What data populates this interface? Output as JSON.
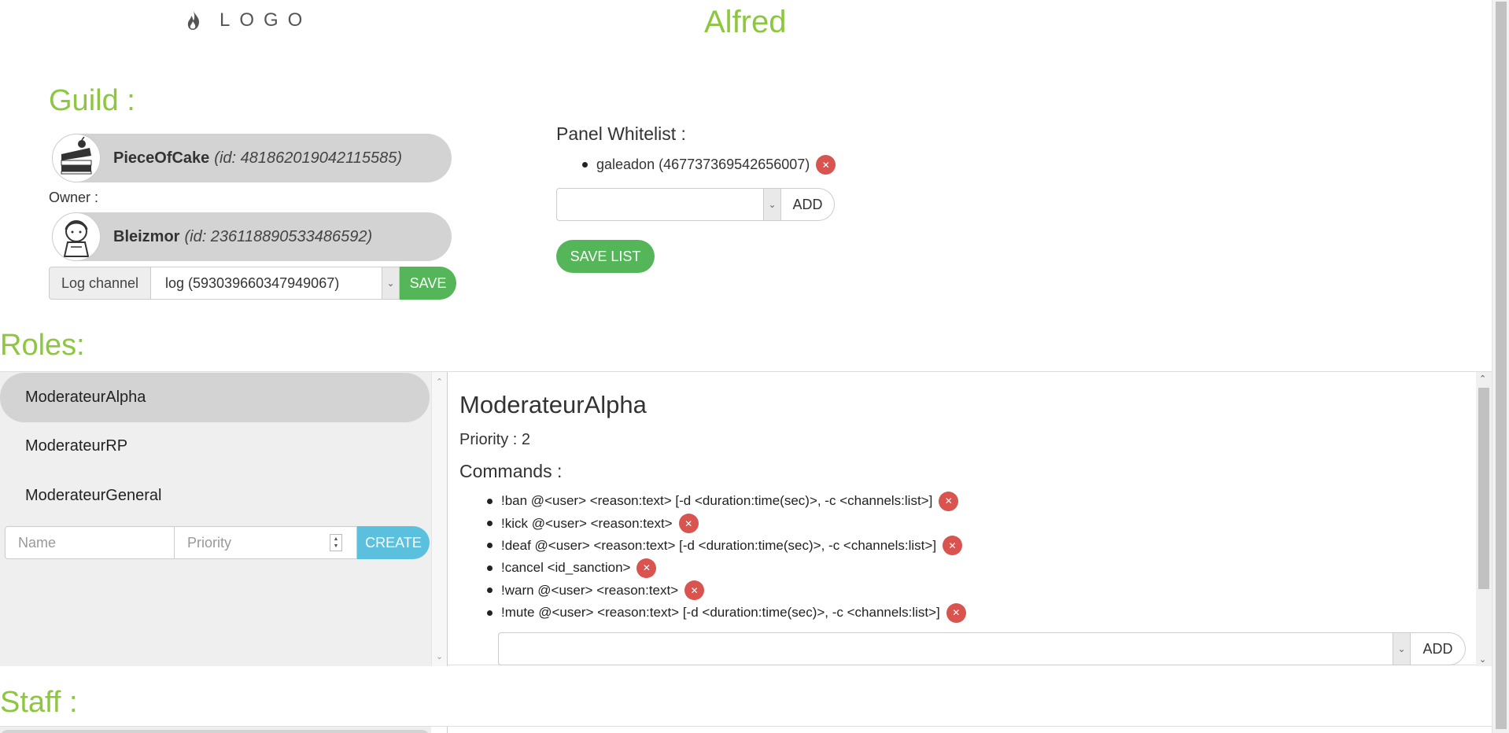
{
  "header": {
    "logo_text": "LOGO",
    "logo_icon": "flame-icon",
    "app_title": "Alfred"
  },
  "guild": {
    "section_title": "Guild :",
    "name": "PieceOfCake",
    "id_text": "(id: 481862019042115585)",
    "owner_label": "Owner :",
    "owner_name": "Bleizmor",
    "owner_id_text": "(id: 236118890533486592)",
    "log_channel_label": "Log channel",
    "log_channel_value": "log (593039660347949067)",
    "save_label": "SAVE"
  },
  "whitelist": {
    "title": "Panel Whitelist :",
    "items": [
      "galeadon (467737369542656007)"
    ],
    "add_label": "ADD",
    "save_list_label": "SAVE LIST"
  },
  "roles": {
    "section_title": "Roles:",
    "items": [
      {
        "label": "ModerateurAlpha",
        "active": true
      },
      {
        "label": "ModerateurRP",
        "active": false
      },
      {
        "label": "ModerateurGeneral",
        "active": false
      }
    ],
    "name_placeholder": "Name",
    "priority_placeholder": "Priority",
    "create_label": "CREATE",
    "selected": {
      "title": "ModerateurAlpha",
      "priority_text": "Priority : 2",
      "commands_title": "Commands :",
      "commands": [
        "!ban @<user> <reason:text> [-d <duration:time(sec)>, -c <channels:list>]",
        "!kick @<user> <reason:text>",
        "!deaf @<user> <reason:text> [-d <duration:time(sec)>, -c <channels:list>]",
        "!cancel <id_sanction>",
        "!warn @<user> <reason:text>",
        "!mute @<user> <reason:text> [-d <duration:time(sec)>, -c <channels:list>]"
      ],
      "add_label": "ADD"
    }
  },
  "staff": {
    "section_title": "Staff :"
  },
  "colors": {
    "accent_green": "#8dc63f",
    "button_green": "#55b559",
    "create_blue": "#5bc0de",
    "delete_red": "#d9534f"
  }
}
